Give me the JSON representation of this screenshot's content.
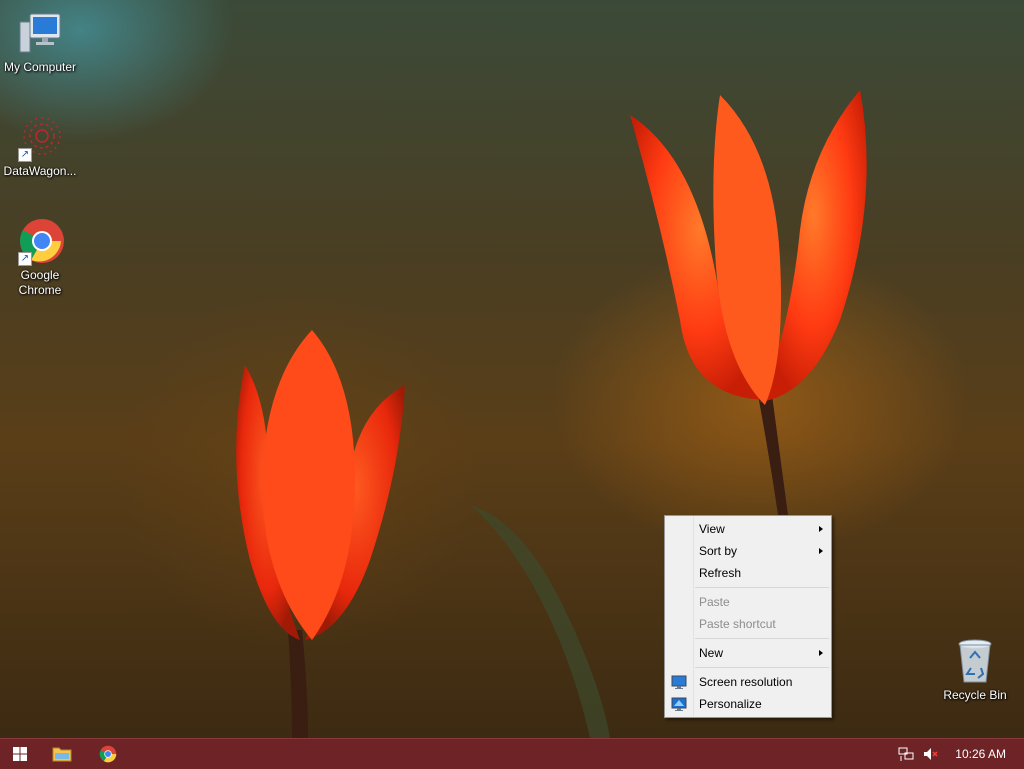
{
  "desktop": {
    "icons": [
      {
        "label": "My Computer"
      },
      {
        "label": "DataWagon..."
      },
      {
        "label": "Google\nChrome"
      },
      {
        "label": "Recycle Bin"
      }
    ]
  },
  "context_menu": {
    "items": [
      {
        "label": "View"
      },
      {
        "label": "Sort by"
      },
      {
        "label": "Refresh"
      },
      {
        "label": "Paste"
      },
      {
        "label": "Paste shortcut"
      },
      {
        "label": "New"
      },
      {
        "label": "Screen resolution"
      },
      {
        "label": "Personalize"
      }
    ]
  },
  "taskbar": {
    "clock": "10:26 AM",
    "start_icon": "windows-logo",
    "pinned": [
      "file-explorer",
      "google-chrome"
    ],
    "tray": [
      "network-icon",
      "volume-muted-icon"
    ],
    "color": "#6e2426"
  },
  "colors": {
    "tulip": "#ff4a1a",
    "menu_bg": "#f0f0f0"
  }
}
